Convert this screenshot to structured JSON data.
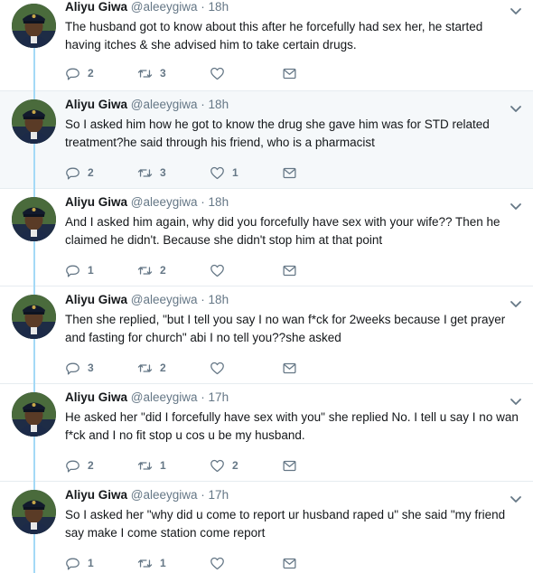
{
  "tweets": [
    {
      "name": "Aliyu Giwa",
      "handle": "@aleeygiwa",
      "time": "18h",
      "text": "The husband got to know about this after he forcefully had sex her, he started having itches & she advised him to take certain drugs.",
      "replies": "2",
      "retweets": "3",
      "likes": ""
    },
    {
      "name": "Aliyu Giwa",
      "handle": "@aleeygiwa",
      "time": "18h",
      "text": "So I asked him how he got to know the drug she gave him was for STD related treatment?he said through his friend, who is a pharmacist",
      "replies": "2",
      "retweets": "3",
      "likes": "1"
    },
    {
      "name": "Aliyu Giwa",
      "handle": "@aleeygiwa",
      "time": "18h",
      "text": "And I asked him again, why did you forcefully have sex with your wife?? Then he claimed he didn't. Because she didn't stop him at that point",
      "replies": "1",
      "retweets": "2",
      "likes": ""
    },
    {
      "name": "Aliyu Giwa",
      "handle": "@aleeygiwa",
      "time": "18h",
      "text": "Then she replied, \"but I tell you say I no wan f*ck for 2weeks because I get prayer and fasting for church\" abi I no tell you??she asked",
      "replies": "3",
      "retweets": "2",
      "likes": ""
    },
    {
      "name": "Aliyu Giwa",
      "handle": "@aleeygiwa",
      "time": "17h",
      "text": "He asked her \"did I forcefully have sex with you\" she replied No. I tell u say I no wan f*ck and I no fit stop u cos u be my husband.",
      "replies": "2",
      "retweets": "1",
      "likes": "2"
    },
    {
      "name": "Aliyu Giwa",
      "handle": "@aleeygiwa",
      "time": "17h",
      "text": "So I asked her \"why did u come to report ur husband raped u\" she said \"my friend say make I come station come report",
      "replies": "1",
      "retweets": "1",
      "likes": ""
    }
  ],
  "colors": {
    "thread_line": "#a4d9f6",
    "highlight_bg": "#f5f8fa",
    "icon": "#657786",
    "text": "#14171a"
  },
  "icons": [
    "reply-icon",
    "retweet-icon",
    "like-icon",
    "dm-icon",
    "caret-down-icon"
  ]
}
